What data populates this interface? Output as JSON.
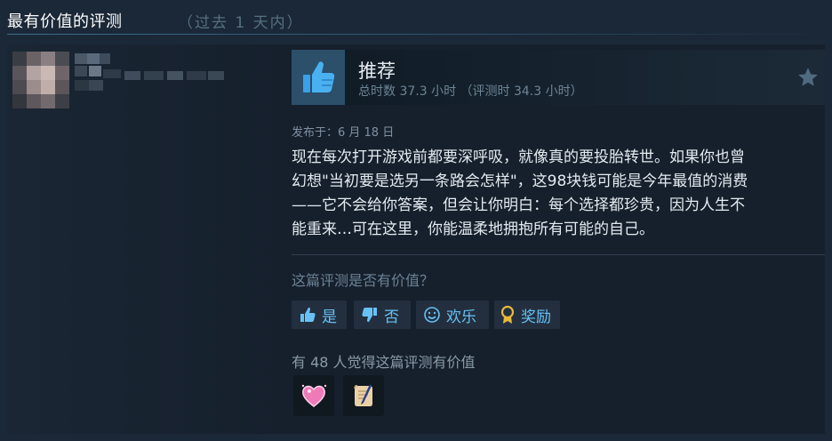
{
  "section": {
    "title": "最有价值的评测",
    "subtitle": "（过去 1 天内）"
  },
  "review": {
    "verdict": "推荐",
    "hours": "总时数 37.3 小时 （评测时 34.3 小时）",
    "posted": "发布于：6 月 18 日",
    "body_lines": [
      "现在每次打开游戏前都要深呼吸，就像真的要投胎转世。如果你也曾",
      "幻想\"当初要是选另一条路会怎样\"，这98块钱可能是今年最值的消费",
      "——它不会给你答案，但会让你明白：每个选择都珍贵，因为人生不",
      "能重来…可在这里，你能温柔地拥抱所有可能的自己。"
    ],
    "helpful_question": "这篇评测是否有价值？",
    "buttons": {
      "yes": "是",
      "no": "否",
      "funny": "欢乐",
      "award": "奖励"
    },
    "helpful_count": "有 48 人觉得这篇评测有价值",
    "icons": {
      "thumb": "thumbs-up-icon",
      "star": "star-icon",
      "yes": "thumbs-up-icon",
      "no": "thumbs-down-icon",
      "funny": "smiley-icon",
      "award": "award-ribbon-icon"
    },
    "awards": [
      "heart-sticker-icon",
      "scroll-quill-icon"
    ]
  },
  "colors": {
    "background": "#1b2838",
    "card": "#16202d",
    "accent": "#67c1f5",
    "thumb_bg": "#2c4f6a"
  }
}
